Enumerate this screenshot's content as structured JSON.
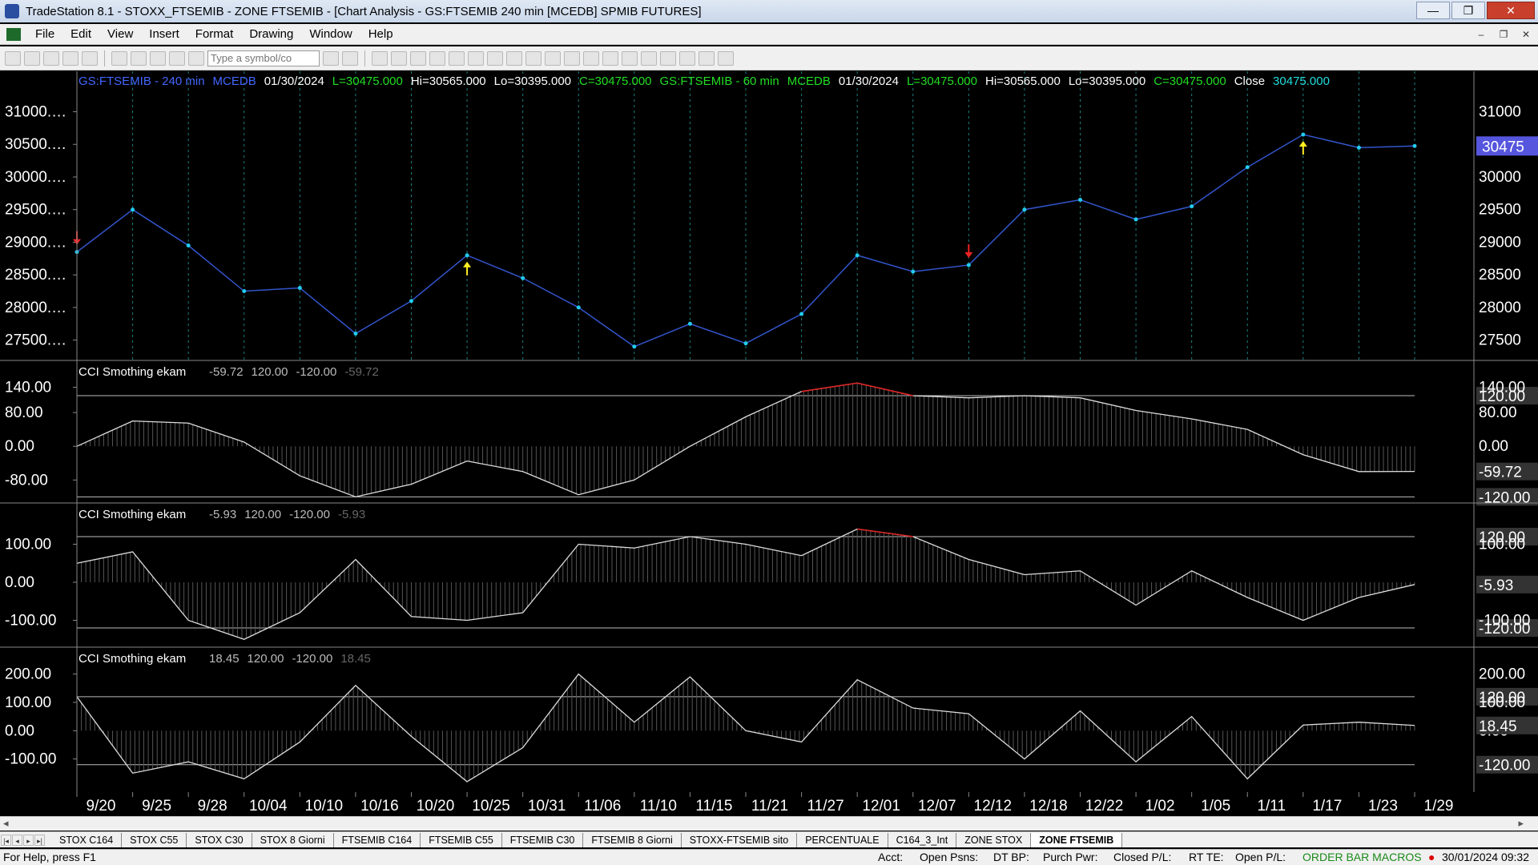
{
  "window": {
    "title": "TradeStation 8.1 - STOXX_FTSEMIB - ZONE FTSEMIB - [Chart Analysis - GS:FTSEMIB  240 min  [MCEDB] SPMIB FUTURES]",
    "minimize": "—",
    "maximize": "❐",
    "close": "✕"
  },
  "menu": {
    "items": [
      "File",
      "Edit",
      "View",
      "Insert",
      "Format",
      "Drawing",
      "Window",
      "Help"
    ],
    "mdi": [
      "–",
      "❐",
      "✕"
    ]
  },
  "toolbar": {
    "symbol_placeholder": "Type a symbol/co"
  },
  "chart_header": {
    "parts": [
      {
        "text": "GS:FTSEMIB - 240 min",
        "color": "#4466ff"
      },
      {
        "text": "MCEDB",
        "color": "#4466ff"
      },
      {
        "text": "01/30/2024",
        "color": "#ffffff"
      },
      {
        "text": "L=30475.000",
        "color": "#22dd22"
      },
      {
        "text": "Hi=30565.000",
        "color": "#ffffff"
      },
      {
        "text": "Lo=30395.000",
        "color": "#ffffff"
      },
      {
        "text": "C=30475.000",
        "color": "#22dd22"
      },
      {
        "text": "GS:FTSEMIB - 60 min",
        "color": "#22dd22"
      },
      {
        "text": "MCEDB",
        "color": "#22dd22"
      },
      {
        "text": "01/30/2024",
        "color": "#ffffff"
      },
      {
        "text": "L=30475.000",
        "color": "#22dd22"
      },
      {
        "text": "Hi=30565.000",
        "color": "#ffffff"
      },
      {
        "text": "Lo=30395.000",
        "color": "#ffffff"
      },
      {
        "text": "C=30475.000",
        "color": "#22dd22"
      },
      {
        "text": "Close",
        "color": "#ffffff"
      },
      {
        "text": "30475.000",
        "color": "#22dddd"
      }
    ]
  },
  "chart_data": [
    {
      "type": "line",
      "x": [
        "9/20",
        "9/25",
        "9/28",
        "10/04",
        "10/10",
        "10/16",
        "10/20",
        "10/25",
        "10/31",
        "11/06",
        "11/10",
        "11/15",
        "11/21",
        "11/27",
        "12/01",
        "12/07",
        "12/12",
        "12/18",
        "12/22",
        "1/02",
        "1/05",
        "1/11",
        "1/17",
        "1/23",
        "1/29"
      ],
      "x_ticks": [
        "9/20",
        "9/25",
        "9/28",
        "10/04",
        "10/10",
        "10/16",
        "10/20",
        "10/25",
        "10/31",
        "11/06",
        "11/10",
        "11/15",
        "11/21",
        "11/27",
        "12/01",
        "12/07",
        "12/12",
        "12/18",
        "12/22",
        "1/02",
        "1/05",
        "1/11",
        "1/17",
        "1/23",
        "1/29"
      ],
      "y_ticks_left": [
        "31000.…",
        "30500.…",
        "30000.…",
        "29500.…",
        "29000.…",
        "28500.…",
        "28000.…",
        "27500.…"
      ],
      "y_ticks_right": [
        "31000",
        "30500",
        "30000",
        "29500",
        "29000",
        "28500",
        "28000",
        "27500"
      ],
      "ylim": [
        27250,
        31350
      ],
      "last_value_label": "30475",
      "series": [
        {
          "color": "#22ccee",
          "values": [
            28850,
            29500,
            28950,
            28250,
            28300,
            27600,
            28100,
            28800,
            28450,
            28000,
            27400,
            27750,
            27450,
            27900,
            28800,
            28550,
            28650,
            29500,
            29650,
            29350,
            29550,
            30150,
            30650,
            30450,
            30475
          ]
        }
      ],
      "arrows": [
        {
          "x": "9/20",
          "direction": "down",
          "color": "#ee2222"
        },
        {
          "x": "10/25",
          "direction": "up",
          "color": "#ffee22"
        },
        {
          "x": "12/12",
          "direction": "down",
          "color": "#ee2222"
        },
        {
          "x": "1/17",
          "direction": "up",
          "color": "#ffee22"
        }
      ]
    },
    {
      "type": "area",
      "title": "CCI Smothing ekam",
      "readouts": [
        "-59.72",
        "120.00",
        "-120.00",
        "-59.72"
      ],
      "y_ticks_left": [
        "140.00",
        "80.00",
        "0.00",
        "-80.00"
      ],
      "y_ticks_right": [
        "140.00",
        "80.00",
        "0.00"
      ],
      "ylim": [
        -125,
        160
      ],
      "levels": [
        120,
        -120
      ],
      "level_labels": [
        "120.00",
        "-120.00"
      ],
      "last_value_label": "-59.72",
      "series": [
        {
          "color": "#dddddd",
          "values": [
            0,
            60,
            55,
            10,
            -70,
            -120,
            -90,
            -35,
            -60,
            -115,
            -80,
            0,
            70,
            130,
            150,
            120,
            115,
            120,
            115,
            85,
            65,
            40,
            -20,
            -60,
            -59.72
          ]
        }
      ]
    },
    {
      "type": "area",
      "title": "CCI Smothing ekam",
      "readouts": [
        "-5.93",
        "120.00",
        "-120.00",
        "-5.93"
      ],
      "y_ticks_left": [
        "100.00",
        "0.00",
        "-100.00"
      ],
      "y_ticks_right": [
        "100.00",
        "0.00",
        "-100.00"
      ],
      "ylim": [
        -160,
        160
      ],
      "levels": [
        120,
        -120
      ],
      "level_labels": [
        "120.00",
        "-120.00"
      ],
      "last_value_label": "-5.93",
      "series": [
        {
          "color": "#dddddd",
          "values": [
            50,
            80,
            -100,
            -150,
            -80,
            60,
            -90,
            -100,
            -80,
            100,
            90,
            120,
            100,
            70,
            140,
            120,
            60,
            20,
            30,
            -60,
            30,
            -40,
            -100,
            -40,
            -5.93
          ]
        }
      ]
    },
    {
      "type": "area",
      "title": "CCI Smothing ekam",
      "readouts": [
        "18.45",
        "120.00",
        "-120.00",
        "18.45"
      ],
      "y_ticks_left": [
        "200.00",
        "100.00",
        "0.00",
        "-100.00"
      ],
      "y_ticks_right": [
        "200.00",
        "100.00",
        "0.00"
      ],
      "ylim": [
        -200,
        230
      ],
      "levels": [
        120,
        -120
      ],
      "level_labels": [
        "120.00",
        "-120.00"
      ],
      "last_value_label": "18.45",
      "series": [
        {
          "color": "#dddddd",
          "values": [
            120,
            -150,
            -110,
            -170,
            -40,
            160,
            -20,
            -180,
            -60,
            200,
            30,
            190,
            0,
            -40,
            180,
            80,
            60,
            -100,
            70,
            -110,
            50,
            -170,
            20,
            30,
            18.45
          ]
        }
      ]
    }
  ],
  "scrollbar": {
    "left_arrow": "◂",
    "right_arrow": "▸"
  },
  "tabs": {
    "nav": [
      "|◂",
      "◂",
      "▸",
      "▸|"
    ],
    "items": [
      "STOX C164",
      "STOX C55",
      "STOX  C30",
      "STOX  8 Giorni",
      "FTSEMIB C164",
      "FTSEMIB C55",
      "FTSEMIB C30",
      "FTSEMIB  8 Giorni",
      "STOXX-FTSEMIB sito",
      "PERCENTUALE",
      "C164_3_Int",
      "ZONE STOX",
      "ZONE FTSEMIB"
    ],
    "active": "ZONE FTSEMIB"
  },
  "status": {
    "help": "For Help, press F1",
    "fields": [
      "Acct:",
      "Open Psns:",
      "DT BP:",
      "Purch Pwr:",
      "Closed P/L:",
      "RT TE:",
      "Open P/L:"
    ],
    "macros": "ORDER BAR  MACROS",
    "datetime": "30/01/2024 09:32"
  }
}
